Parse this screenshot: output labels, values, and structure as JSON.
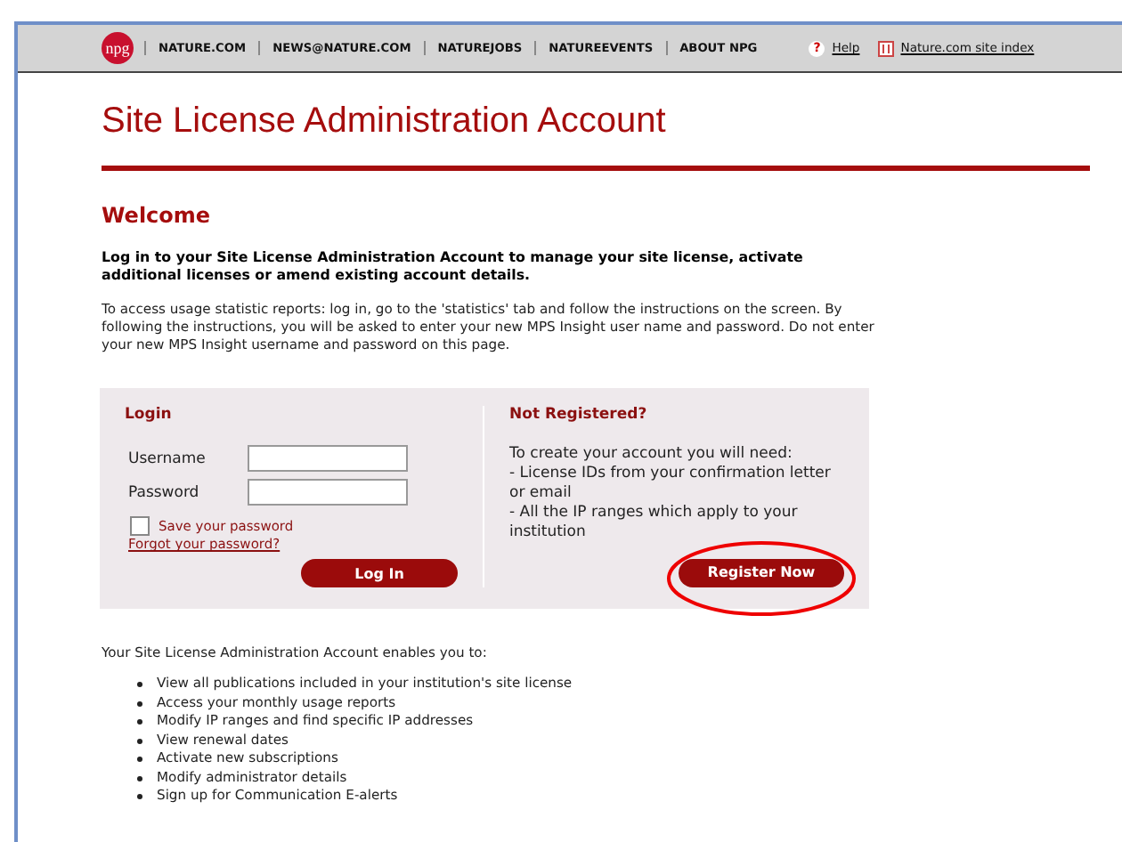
{
  "top_nav": {
    "logo": "npg",
    "links": [
      "NATURE.COM",
      "NEWS@NATURE.COM",
      "NATUREJOBS",
      "NATUREEVENTS",
      "ABOUT NPG"
    ],
    "help_icon": "?",
    "help": "Help",
    "site_index": "Nature.com site index"
  },
  "page_title": "Site License Administration Account",
  "welcome": {
    "heading": "Welcome",
    "lead": "Log in to your Site License Administration Account to manage your site license, activate additional licenses or amend existing account details.",
    "note": "To access usage statistic reports: log in, go to the 'statistics' tab and follow the instructions on the screen. By following the instructions, you will be asked to enter your new MPS Insight user name and password. Do not enter your new MPS Insight username and password on this page."
  },
  "login": {
    "heading": "Login",
    "fields": [
      {
        "label": "Username"
      },
      {
        "label": "Password"
      }
    ],
    "save_password": {
      "label": "Save your password",
      "checked": false
    },
    "forgot": "Forgot your password?",
    "button": "Log In"
  },
  "register": {
    "heading": "Not Registered?",
    "lines": [
      "To create your account you will need:",
      "- License IDs from your confirmation letter or email",
      "- All the IP ranges which apply to your institution"
    ],
    "button": "Register Now",
    "highlighted": true
  },
  "features": {
    "intro": "Your Site License Administration Account enables you to:",
    "items": [
      "View all publications included in your institution's site license",
      "Access your monthly usage reports",
      "Modify IP ranges and find specific IP addresses",
      "View renewal dates",
      "Activate new subscriptions",
      "Modify administrator details",
      "Sign up for Communication E-alerts"
    ]
  }
}
